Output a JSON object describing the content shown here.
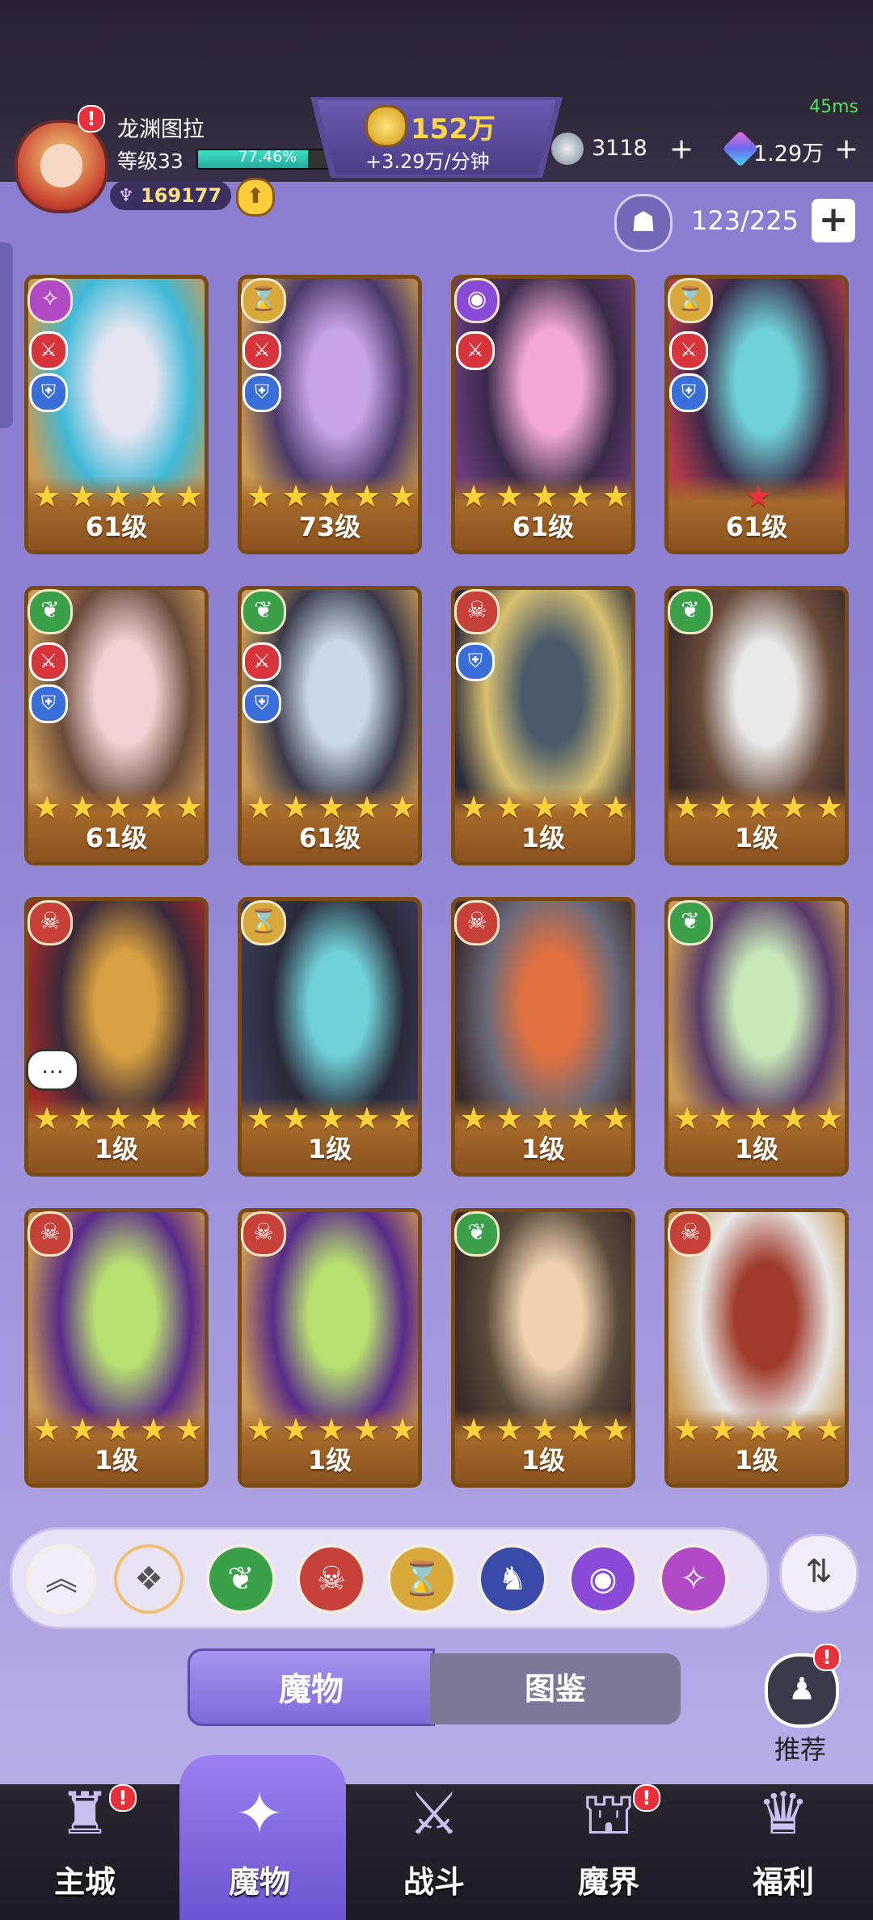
{
  "status": {
    "ping": "45ms"
  },
  "player": {
    "name": "龙渊图拉",
    "level": "等级33",
    "xp_percent": "77.46%",
    "xp_fraction": 0.7746,
    "power": "169177"
  },
  "currency": {
    "gold": "152万",
    "gold_rate": "+3.29万/分钟",
    "crystal": "3118",
    "gems": "1.29万",
    "plus": "+"
  },
  "roster": {
    "capacity": "123/225",
    "add": "+"
  },
  "cards": [
    {
      "level": "61级",
      "faction": "arcane-icon",
      "faction_color": "#b24ac8",
      "stars": 5,
      "red_star": false,
      "atk": true,
      "def": true,
      "art": [
        "#c99a55",
        "#e6e4f0",
        "#3fb9d8"
      ]
    },
    {
      "level": "73级",
      "faction": "hourglass-icon",
      "faction_color": "#d8a83a",
      "stars": 5,
      "red_star": false,
      "atk": true,
      "def": true,
      "art": [
        "#c99a55",
        "#c9a3e8",
        "#4a3a6a"
      ]
    },
    {
      "level": "61级",
      "faction": "eye-icon",
      "faction_color": "#8a4ad8",
      "stars": 5,
      "red_star": false,
      "atk": true,
      "def": false,
      "art": [
        "#6a3a7a",
        "#f2a7d8",
        "#3a2a4a"
      ]
    },
    {
      "level": "61级",
      "faction": "hourglass-icon",
      "faction_color": "#d8a83a",
      "stars": 1,
      "red_star": true,
      "atk": true,
      "def": true,
      "art": [
        "#b23a4a",
        "#6fd0d8",
        "#3a2a4a"
      ]
    },
    {
      "level": "61级",
      "faction": "leaf-icon",
      "faction_color": "#3aa04a",
      "stars": 5,
      "red_star": false,
      "atk": true,
      "def": true,
      "art": [
        "#c99a55",
        "#f0d0d0",
        "#6a4a3a"
      ]
    },
    {
      "level": "61级",
      "faction": "leaf-icon",
      "faction_color": "#3aa04a",
      "stars": 5,
      "red_star": false,
      "atk": true,
      "def": true,
      "art": [
        "#c99a55",
        "#c8d8e8",
        "#3a3a4a"
      ]
    },
    {
      "level": "1级",
      "faction": "skull-icon",
      "faction_color": "#c8403a",
      "stars": 5,
      "red_star": false,
      "atk": false,
      "def": true,
      "art": [
        "#2a2a3a",
        "#4a5a6a",
        "#d8c070"
      ]
    },
    {
      "level": "1级",
      "faction": "leaf-icon",
      "faction_color": "#3aa04a",
      "stars": 5,
      "red_star": false,
      "atk": false,
      "def": false,
      "art": [
        "#3a2a2a",
        "#e8e8e8",
        "#6a4a3a"
      ]
    },
    {
      "level": "1级",
      "faction": "skull-icon",
      "faction_color": "#c8403a",
      "stars": 5,
      "red_star": false,
      "atk": false,
      "def": false,
      "art": [
        "#a02a2a",
        "#d8a040",
        "#3a2a3a"
      ]
    },
    {
      "level": "1级",
      "faction": "hourglass-icon",
      "faction_color": "#d8a83a",
      "stars": 5,
      "red_star": false,
      "atk": false,
      "def": false,
      "art": [
        "#3a3a5a",
        "#6fd0d8",
        "#2a2a3a"
      ]
    },
    {
      "level": "1级",
      "faction": "skull-icon",
      "faction_color": "#c8403a",
      "stars": 5,
      "red_star": false,
      "atk": false,
      "def": false,
      "art": [
        "#3a2a2a",
        "#e07040",
        "#6a6a7a"
      ]
    },
    {
      "level": "1级",
      "faction": "leaf-icon",
      "faction_color": "#3aa04a",
      "stars": 5,
      "red_star": false,
      "atk": false,
      "def": false,
      "art": [
        "#c99a55",
        "#c8e8b8",
        "#5a3a6a"
      ]
    },
    {
      "level": "1级",
      "faction": "skull-icon",
      "faction_color": "#c8403a",
      "stars": 5,
      "red_star": false,
      "atk": false,
      "def": false,
      "art": [
        "#c99a55",
        "#b8e070",
        "#5a2a8a"
      ]
    },
    {
      "level": "1级",
      "faction": "skull-icon",
      "faction_color": "#c8403a",
      "stars": 5,
      "red_star": false,
      "atk": false,
      "def": false,
      "art": [
        "#c99a55",
        "#b8e070",
        "#5a2a8a"
      ]
    },
    {
      "level": "1级",
      "faction": "leaf-icon",
      "faction_color": "#3aa04a",
      "stars": 5,
      "red_star": false,
      "atk": false,
      "def": false,
      "art": [
        "#3a2a2a",
        "#f0d0b0",
        "#5a4a3a"
      ]
    },
    {
      "level": "1级",
      "faction": "skull-icon",
      "faction_color": "#c8403a",
      "stars": 5,
      "red_star": false,
      "atk": false,
      "def": false,
      "art": [
        "#c99a55",
        "#a03a2a",
        "#e8e8e8"
      ]
    }
  ],
  "filters": [
    {
      "name": "collapse",
      "icon": "double-chevron-up-icon",
      "color": "#f2eef9",
      "glyph": "︽"
    },
    {
      "name": "all",
      "icon": "diamond-grid-icon",
      "color": "#e8e4f4",
      "glyph": "❖"
    },
    {
      "name": "nature",
      "icon": "leaf-icon",
      "color": "#3aa04a",
      "glyph": "❦"
    },
    {
      "name": "demon",
      "icon": "skull-icon",
      "color": "#c8403a",
      "glyph": "☠"
    },
    {
      "name": "time",
      "icon": "hourglass-icon",
      "color": "#d8a83a",
      "glyph": "⌛"
    },
    {
      "name": "dragon",
      "icon": "dragon-icon",
      "color": "#3a4aa8",
      "glyph": "♞"
    },
    {
      "name": "eye",
      "icon": "eye-icon",
      "color": "#8a4ad8",
      "glyph": "◉"
    },
    {
      "name": "arcane",
      "icon": "arcane-icon",
      "color": "#b24ac8",
      "glyph": "✧"
    }
  ],
  "tabs": {
    "monsters": "魔物",
    "codex": "图鉴"
  },
  "recommend": {
    "label": "推荐"
  },
  "nav": [
    {
      "label": "主城",
      "icon": "castle-icon",
      "glyph": "♜",
      "alert": true
    },
    {
      "label": "魔物",
      "icon": "flame-icon",
      "glyph": "✦",
      "alert": false
    },
    {
      "label": "战斗",
      "icon": "sword-shield-icon",
      "glyph": "⚔",
      "alert": false
    },
    {
      "label": "魔界",
      "icon": "portal-icon",
      "glyph": "⛫",
      "alert": true
    },
    {
      "label": "福利",
      "icon": "treasure-chest-icon",
      "glyph": "♛",
      "alert": false
    }
  ]
}
